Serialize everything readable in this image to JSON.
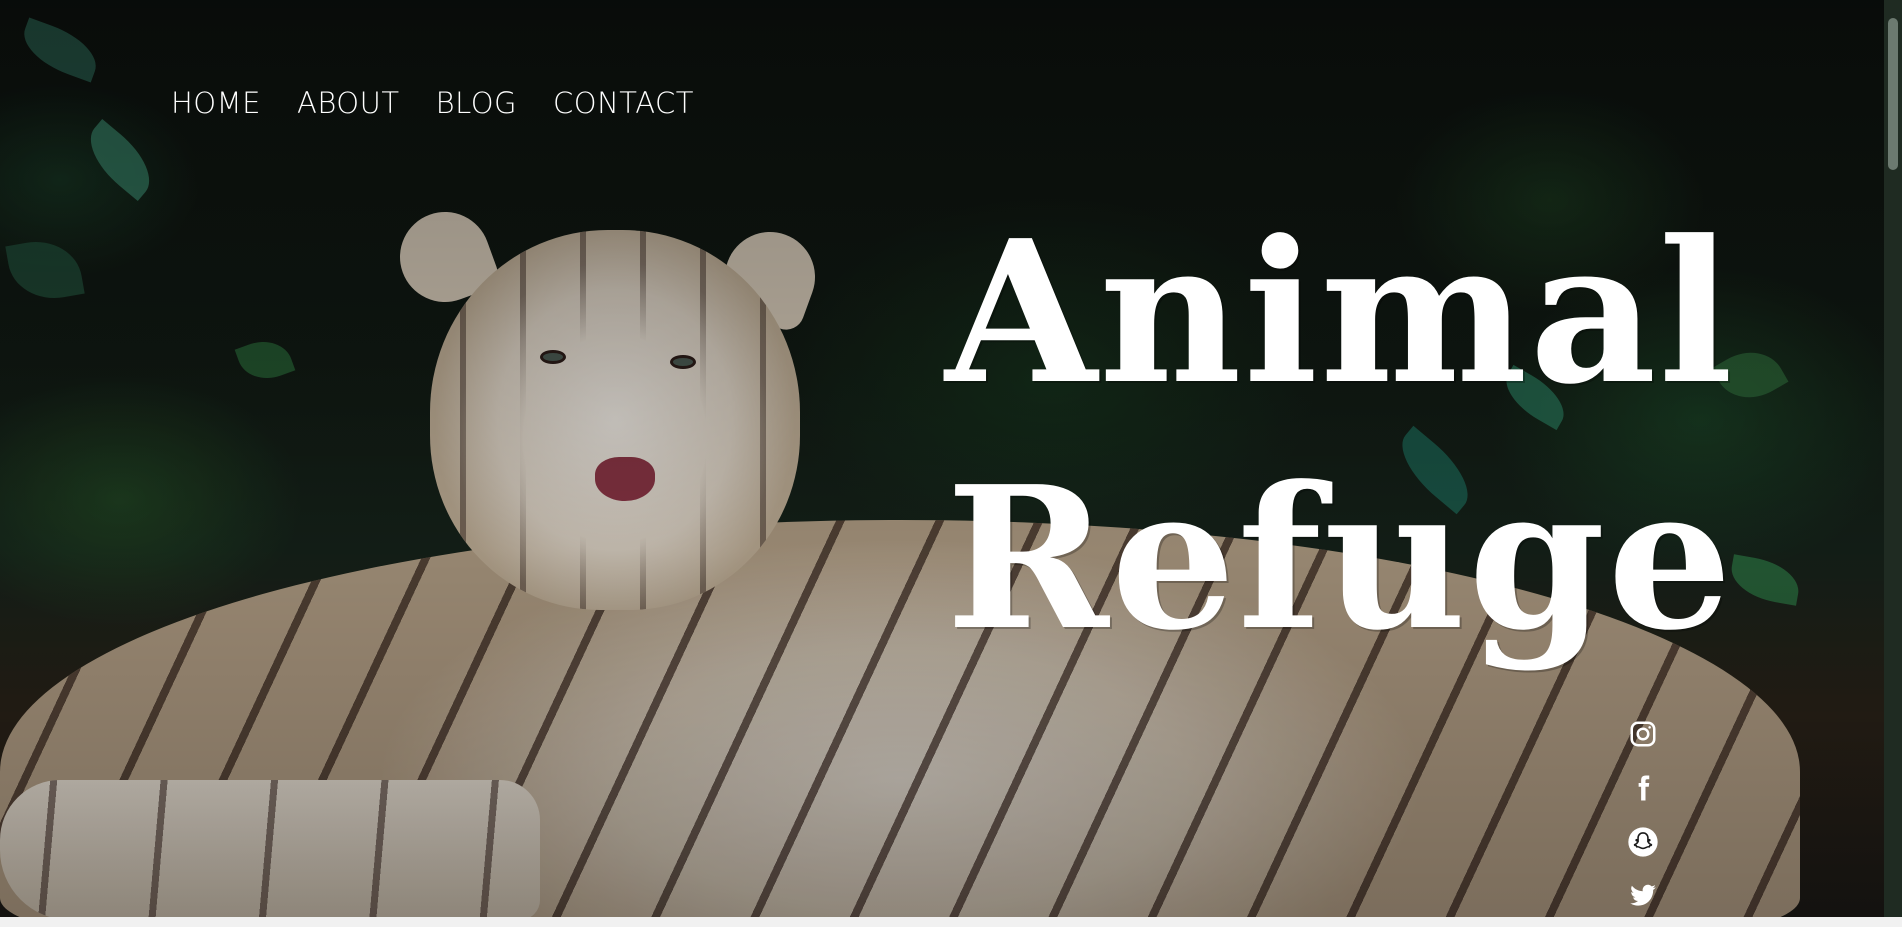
{
  "nav": {
    "items": [
      {
        "label": "HOME"
      },
      {
        "label": "ABOUT"
      },
      {
        "label": "BLOG"
      },
      {
        "label": "CONTACT"
      }
    ]
  },
  "hero": {
    "title_line1": "Animal",
    "title_line2": "Refuge"
  },
  "social": {
    "icons": [
      "instagram-icon",
      "facebook-icon",
      "snapchat-icon",
      "twitter-icon"
    ]
  },
  "colors": {
    "text": "#ffffff",
    "scrollbar_track": "#1f2b22",
    "scrollbar_thumb": "#6c7a70"
  }
}
